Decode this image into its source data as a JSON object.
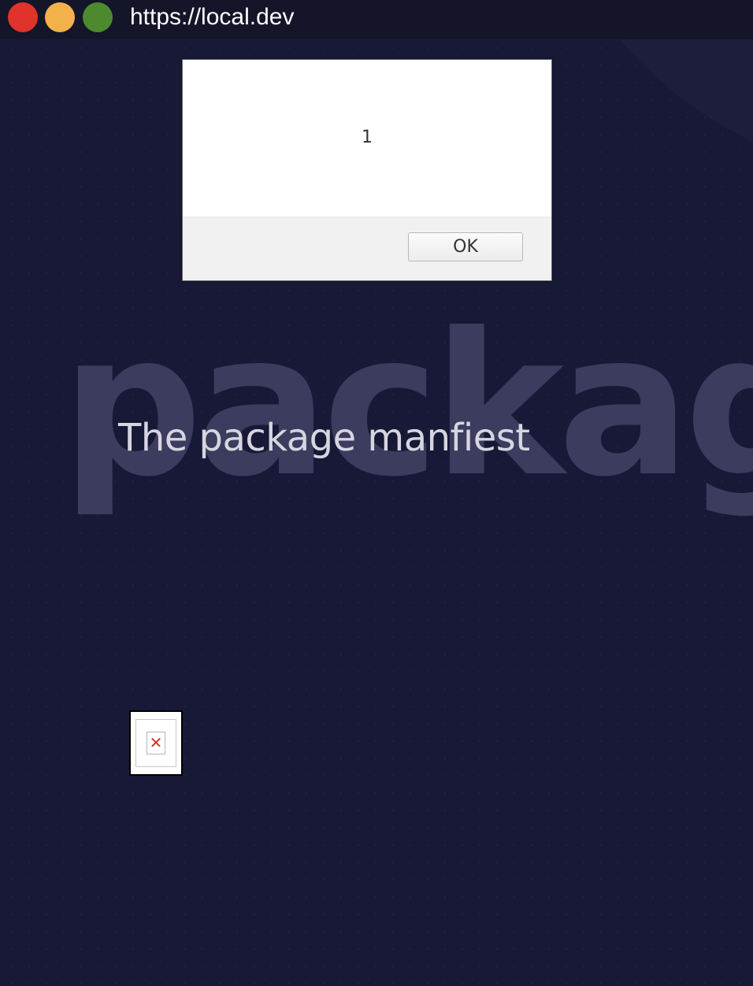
{
  "browser": {
    "url": "https://local.dev",
    "buttons": [
      "close",
      "minimize",
      "maximize"
    ]
  },
  "hero": {
    "background_word": "package",
    "title": "The package manfiest"
  },
  "alert": {
    "message": "1",
    "ok_label": "OK"
  },
  "broken_image": {
    "icon": "broken-image-icon",
    "glyph": "✕"
  },
  "colors": {
    "background": "#181937",
    "titlebar": "#141529",
    "close_dot": "#e0332b",
    "minimize_dot": "#f2b14a",
    "maximize_dot": "#4d8a2d",
    "hero_word": "#3b3c5e"
  }
}
